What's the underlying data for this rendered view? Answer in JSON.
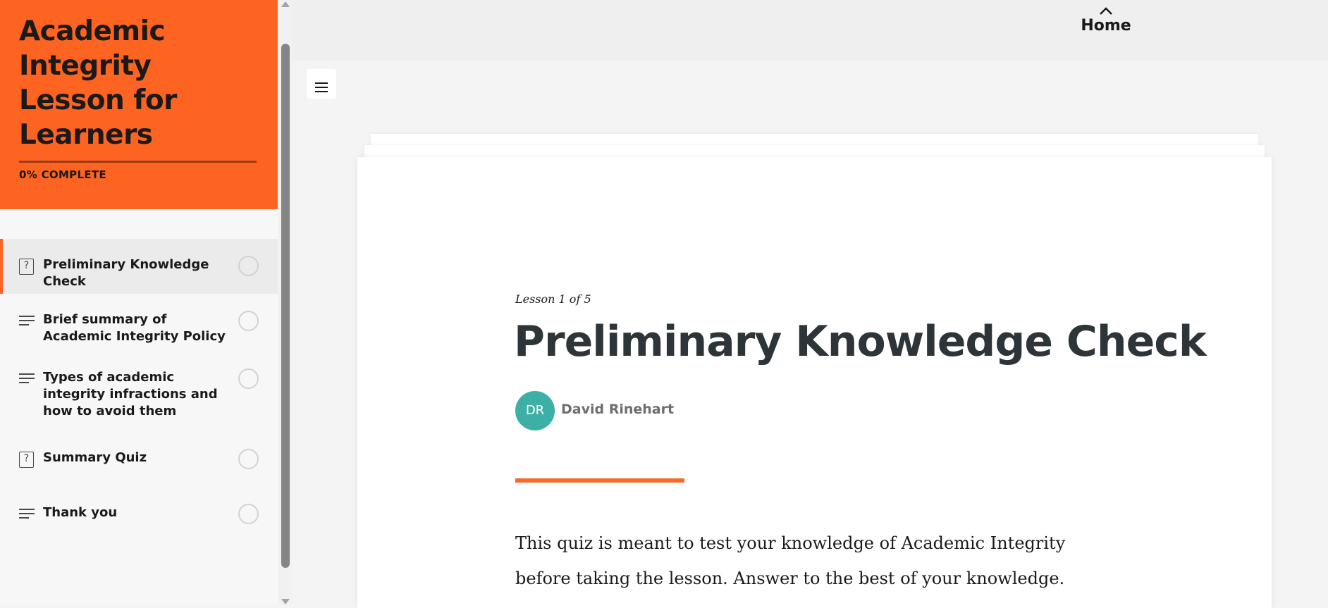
{
  "course": {
    "title": "Academic Integrity Lesson for Learners",
    "progress_label": "0% COMPLETE",
    "progress_fraction": 0,
    "accent_color": "#fd6321"
  },
  "lessons": [
    {
      "label": "Preliminary Knowledge Check",
      "icon": "quiz-icon",
      "active": true,
      "completed": false
    },
    {
      "label": "Brief summary of Academic Integrity Policy",
      "icon": "text-lines-icon",
      "active": false,
      "completed": false
    },
    {
      "label": "Types of academic integrity infractions and how to avoid them",
      "icon": "text-lines-icon",
      "active": false,
      "completed": false
    },
    {
      "label": "Summary Quiz",
      "icon": "quiz-icon",
      "active": false,
      "completed": false
    },
    {
      "label": "Thank you",
      "icon": "text-lines-icon",
      "active": false,
      "completed": false
    }
  ],
  "nav": {
    "home_label": "Home",
    "home_icon": "chevron-up-icon",
    "menu_icon": "hamburger-menu-icon"
  },
  "content": {
    "lesson_counter": "Lesson 1 of 5",
    "title": "Preliminary Knowledge Check",
    "author": {
      "initials": "DR",
      "name": "David Rinehart",
      "avatar_color": "#3cb0a5"
    },
    "intro": "This quiz is meant to test your knowledge of Academic Integrity before taking the lesson. Answer to the best of your knowledge."
  }
}
